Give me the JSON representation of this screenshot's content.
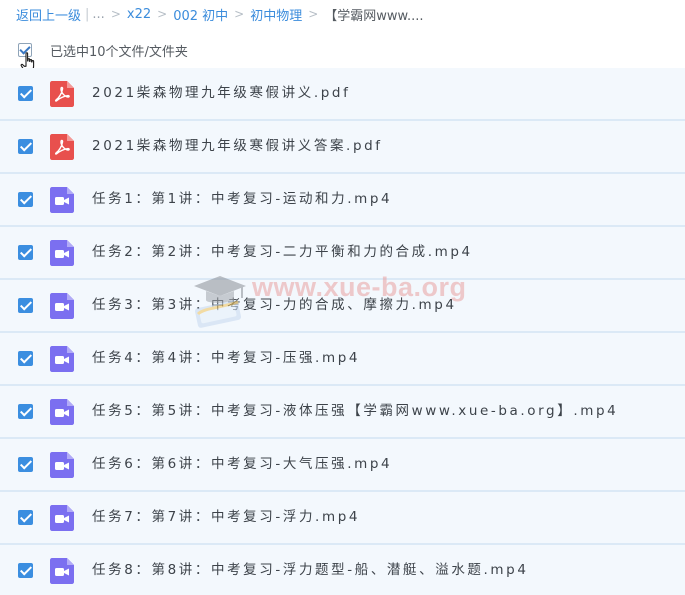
{
  "breadcrumb": {
    "back_label": "返回上一级",
    "separator_bar": "|",
    "ellipsis": "...",
    "items": [
      "x22",
      "002 初中",
      "初中物理"
    ],
    "current": "【学霸网www...."
  },
  "selection": {
    "summary": "已选中10个文件/文件夹"
  },
  "files": [
    {
      "name": "2021柴森物理九年级寒假讲义.pdf",
      "type": "pdf",
      "checked": true
    },
    {
      "name": "2021柴森物理九年级寒假讲义答案.pdf",
      "type": "pdf",
      "checked": true
    },
    {
      "name": "任务1：第1讲：中考复习-运动和力.mp4",
      "type": "video",
      "checked": true
    },
    {
      "name": "任务2：第2讲：中考复习-二力平衡和力的合成.mp4",
      "type": "video",
      "checked": true
    },
    {
      "name": "任务3：第3讲：中考复习-力的合成、摩擦力.mp4",
      "type": "video",
      "checked": true
    },
    {
      "name": "任务4：第4讲：中考复习-压强.mp4",
      "type": "video",
      "checked": true
    },
    {
      "name": "任务5：第5讲：中考复习-液体压强【学霸网www.xue-ba.org】.mp4",
      "type": "video",
      "checked": true
    },
    {
      "name": "任务6：第6讲：中考复习-大气压强.mp4",
      "type": "video",
      "checked": true
    },
    {
      "name": "任务7：第7讲：中考复习-浮力.mp4",
      "type": "video",
      "checked": true
    },
    {
      "name": "任务8：第8讲：中考复习-浮力题型-船、潜艇、溢水题.mp4",
      "type": "video",
      "checked": true
    }
  ],
  "watermark": {
    "text": "www.xue-ba.org"
  },
  "colors": {
    "accent": "#3b8ee0",
    "pdf_icon": "#e8504d",
    "video_icon": "#7b6ff0",
    "row_bg": "#f3f8fd"
  }
}
